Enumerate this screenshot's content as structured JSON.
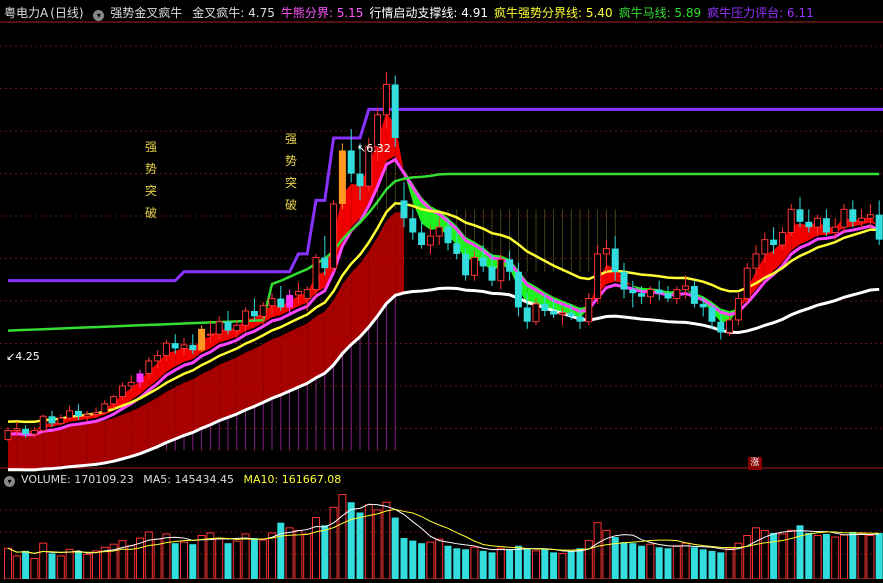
{
  "header": {
    "symbol": "粤电力A",
    "period": "(日线)",
    "indicator": "强势金叉疯牛",
    "items": [
      {
        "label": "金叉疯牛",
        "value": "4.75",
        "color": "#dddddd"
      },
      {
        "label": "牛熊分界",
        "value": "5.15",
        "color": "#ff55ff"
      },
      {
        "label": "行情启动支撑线",
        "value": "4.91",
        "color": "#ffffff"
      },
      {
        "label": "疯牛强势分界线",
        "value": "5.40",
        "color": "#ffff33"
      },
      {
        "label": "疯牛马线",
        "value": "5.89",
        "color": "#33dd33"
      },
      {
        "label": "疯牛压力评台",
        "value": "6.11",
        "color": "#9933ff"
      }
    ]
  },
  "annotations": {
    "breakout1": [
      "强",
      "势",
      "突",
      "破"
    ],
    "breakout2": [
      "强",
      "势",
      "突",
      "破"
    ],
    "high_label": "6.32",
    "low_label": "4.25",
    "zhang": "涨"
  },
  "volume_header": {
    "volume_label": "VOLUME",
    "volume_value": "170109.23",
    "ma5_label": "MA5",
    "ma5_value": "145434.45",
    "ma10_label": "MA10",
    "ma10_value": "161667.08"
  },
  "colors": {
    "up": "#ff3333",
    "down": "#33dddd",
    "signal": "#ff9922",
    "magenta_candle": "#ff33ff",
    "purple": "#8833ff",
    "green": "#33dd33",
    "yellow": "#ffff33",
    "pink": "#ff44ff",
    "white": "#ffffff",
    "fill_red": "#ff0000",
    "fill_green": "#22ff22",
    "grid": "#661111"
  },
  "chart_data": {
    "type": "candlestick",
    "ylim": [
      4.1,
      6.6
    ],
    "candles": [
      [
        4.26,
        4.33,
        4.25,
        4.31
      ],
      [
        4.31,
        4.36,
        4.28,
        4.32
      ],
      [
        4.32,
        4.34,
        4.27,
        4.29
      ],
      [
        4.29,
        4.33,
        4.27,
        4.31
      ],
      [
        4.31,
        4.4,
        4.3,
        4.39
      ],
      [
        4.39,
        4.42,
        4.33,
        4.35
      ],
      [
        4.35,
        4.4,
        4.34,
        4.38
      ],
      [
        4.38,
        4.45,
        4.37,
        4.42
      ],
      [
        4.42,
        4.46,
        4.37,
        4.39
      ],
      [
        4.39,
        4.42,
        4.36,
        4.4
      ],
      [
        4.4,
        4.44,
        4.38,
        4.41
      ],
      [
        4.41,
        4.48,
        4.4,
        4.46
      ],
      [
        4.46,
        4.51,
        4.43,
        4.5
      ],
      [
        4.5,
        4.58,
        4.48,
        4.56
      ],
      [
        4.56,
        4.62,
        4.53,
        4.58
      ],
      [
        4.58,
        4.65,
        4.55,
        4.63
      ],
      [
        4.63,
        4.72,
        4.6,
        4.7
      ],
      [
        4.7,
        4.76,
        4.66,
        4.73
      ],
      [
        4.73,
        4.82,
        4.7,
        4.8
      ],
      [
        4.8,
        4.85,
        4.74,
        4.77
      ],
      [
        4.77,
        4.83,
        4.73,
        4.79
      ],
      [
        4.79,
        4.85,
        4.74,
        4.76
      ],
      [
        4.76,
        4.9,
        4.75,
        4.88
      ],
      [
        4.85,
        4.92,
        4.8,
        4.85
      ],
      [
        4.85,
        4.95,
        4.82,
        4.92
      ],
      [
        4.92,
        4.98,
        4.85,
        4.87
      ],
      [
        4.87,
        4.93,
        4.82,
        4.9
      ],
      [
        4.9,
        5,
        4.86,
        4.98
      ],
      [
        4.98,
        5.05,
        4.92,
        4.95
      ],
      [
        4.95,
        5.03,
        4.9,
        5.01
      ],
      [
        5.01,
        5.08,
        4.96,
        5.05
      ],
      [
        5.05,
        5.12,
        4.98,
        5
      ],
      [
        5,
        5.1,
        4.96,
        5.07
      ],
      [
        5.07,
        5.14,
        5.02,
        5.09
      ],
      [
        5.05,
        5.12,
        4.98,
        5.1
      ],
      [
        5.1,
        5.3,
        5.06,
        5.28
      ],
      [
        5.28,
        5.4,
        5.18,
        5.22
      ],
      [
        5.22,
        5.6,
        5.2,
        5.58
      ],
      [
        5.58,
        5.92,
        5.55,
        5.88
      ],
      [
        5.88,
        6,
        5.7,
        5.75
      ],
      [
        5.75,
        5.92,
        5.6,
        5.68
      ],
      [
        5.68,
        5.95,
        5.65,
        5.9
      ],
      [
        5.9,
        6.12,
        5.82,
        6.08
      ],
      [
        6.08,
        6.32,
        6,
        6.25
      ],
      [
        6.25,
        6.3,
        5.9,
        5.95
      ],
      [
        5.6,
        5.7,
        5.45,
        5.5
      ],
      [
        5.5,
        5.55,
        5.38,
        5.42
      ],
      [
        5.42,
        5.48,
        5.33,
        5.35
      ],
      [
        5.35,
        5.45,
        5.3,
        5.4
      ],
      [
        5.4,
        5.5,
        5.35,
        5.45
      ],
      [
        5.45,
        5.5,
        5.32,
        5.36
      ],
      [
        5.36,
        5.42,
        5.27,
        5.3
      ],
      [
        5.3,
        5.33,
        5.15,
        5.18
      ],
      [
        5.18,
        5.32,
        5.15,
        5.28
      ],
      [
        5.28,
        5.35,
        5.2,
        5.23
      ],
      [
        5.23,
        5.3,
        5.12,
        5.15
      ],
      [
        5.15,
        5.3,
        5.1,
        5.27
      ],
      [
        5.27,
        5.32,
        5.15,
        5.2
      ],
      [
        5.2,
        5.25,
        4.95,
        5
      ],
      [
        5,
        5.08,
        4.88,
        4.92
      ],
      [
        4.92,
        5.05,
        4.9,
        5.02
      ],
      [
        5.02,
        5.08,
        4.95,
        4.98
      ],
      [
        4.98,
        5.05,
        4.94,
        4.96
      ],
      [
        4.96,
        5,
        4.9,
        4.97
      ],
      [
        4.97,
        5.02,
        4.93,
        4.95
      ],
      [
        4.95,
        5,
        4.88,
        4.92
      ],
      [
        4.92,
        5.08,
        4.9,
        5.05
      ],
      [
        5.05,
        5.35,
        5.02,
        5.3
      ],
      [
        5.3,
        5.38,
        5.2,
        5.33
      ],
      [
        5.33,
        5.4,
        5.15,
        5.2
      ],
      [
        5.2,
        5.25,
        5.05,
        5.1
      ],
      [
        5.1,
        5.15,
        5,
        5.08
      ],
      [
        5.08,
        5.12,
        5.02,
        5.06
      ],
      [
        5.06,
        5.12,
        5.02,
        5.1
      ],
      [
        5.1,
        5.15,
        5.04,
        5.08
      ],
      [
        5.08,
        5.12,
        5.03,
        5.05
      ],
      [
        5.05,
        5.12,
        5.02,
        5.1
      ],
      [
        5.1,
        5.18,
        5.05,
        5.12
      ],
      [
        5.12,
        5.15,
        5,
        5.02
      ],
      [
        5.02,
        5.06,
        4.95,
        5
      ],
      [
        5,
        5.02,
        4.88,
        4.92
      ],
      [
        4.92,
        4.96,
        4.82,
        4.86
      ],
      [
        4.86,
        4.95,
        4.84,
        4.93
      ],
      [
        4.93,
        5.08,
        4.9,
        5.05
      ],
      [
        5.05,
        5.25,
        5.02,
        5.22
      ],
      [
        5.22,
        5.35,
        5.18,
        5.3
      ],
      [
        5.3,
        5.42,
        5.25,
        5.38
      ],
      [
        5.38,
        5.45,
        5.3,
        5.35
      ],
      [
        5.35,
        5.45,
        5.32,
        5.42
      ],
      [
        5.42,
        5.58,
        5.4,
        5.55
      ],
      [
        5.55,
        5.62,
        5.45,
        5.48
      ],
      [
        5.48,
        5.55,
        5.42,
        5.45
      ],
      [
        5.45,
        5.52,
        5.4,
        5.5
      ],
      [
        5.5,
        5.55,
        5.4,
        5.42
      ],
      [
        5.42,
        5.5,
        5.38,
        5.45
      ],
      [
        5.45,
        5.58,
        5.42,
        5.55
      ],
      [
        5.55,
        5.6,
        5.45,
        5.48
      ],
      [
        5.48,
        5.55,
        5.44,
        5.5
      ],
      [
        5.5,
        5.58,
        5.45,
        5.52
      ],
      [
        5.52,
        5.6,
        5.35,
        5.38
      ]
    ],
    "volume": [
      60,
      45,
      55,
      40,
      70,
      50,
      45,
      58,
      52,
      48,
      55,
      62,
      68,
      75,
      65,
      80,
      92,
      78,
      88,
      70,
      72,
      68,
      85,
      90,
      78,
      70,
      74,
      88,
      80,
      76,
      90,
      110,
      100,
      95,
      88,
      120,
      105,
      140,
      165,
      150,
      130,
      145,
      135,
      150,
      120,
      80,
      75,
      70,
      72,
      78,
      65,
      60,
      58,
      62,
      55,
      52,
      60,
      58,
      65,
      60,
      55,
      58,
      52,
      50,
      55,
      60,
      75,
      110,
      95,
      82,
      72,
      70,
      65,
      68,
      62,
      60,
      65,
      70,
      62,
      58,
      55,
      52,
      60,
      70,
      85,
      100,
      95,
      90,
      88,
      95,
      105,
      90,
      85,
      88,
      82,
      86,
      92,
      88,
      85,
      90
    ],
    "volume_up": [
      1,
      1,
      0,
      1,
      1,
      0,
      1,
      1,
      0,
      1,
      1,
      1,
      1,
      1,
      1,
      1,
      1,
      1,
      1,
      0,
      1,
      0,
      1,
      1,
      1,
      0,
      1,
      1,
      0,
      1,
      1,
      0,
      1,
      1,
      1,
      1,
      0,
      1,
      1,
      0,
      0,
      1,
      1,
      1,
      0,
      0,
      0,
      0,
      1,
      1,
      0,
      0,
      0,
      1,
      0,
      0,
      1,
      0,
      0,
      0,
      1,
      0,
      0,
      1,
      0,
      0,
      1,
      1,
      1,
      0,
      0,
      0,
      0,
      1,
      0,
      0,
      1,
      1,
      0,
      0,
      0,
      0,
      1,
      1,
      1,
      1,
      1,
      0,
      1,
      1,
      0,
      0,
      1,
      0,
      1,
      1,
      0,
      1,
      1,
      0
    ]
  }
}
